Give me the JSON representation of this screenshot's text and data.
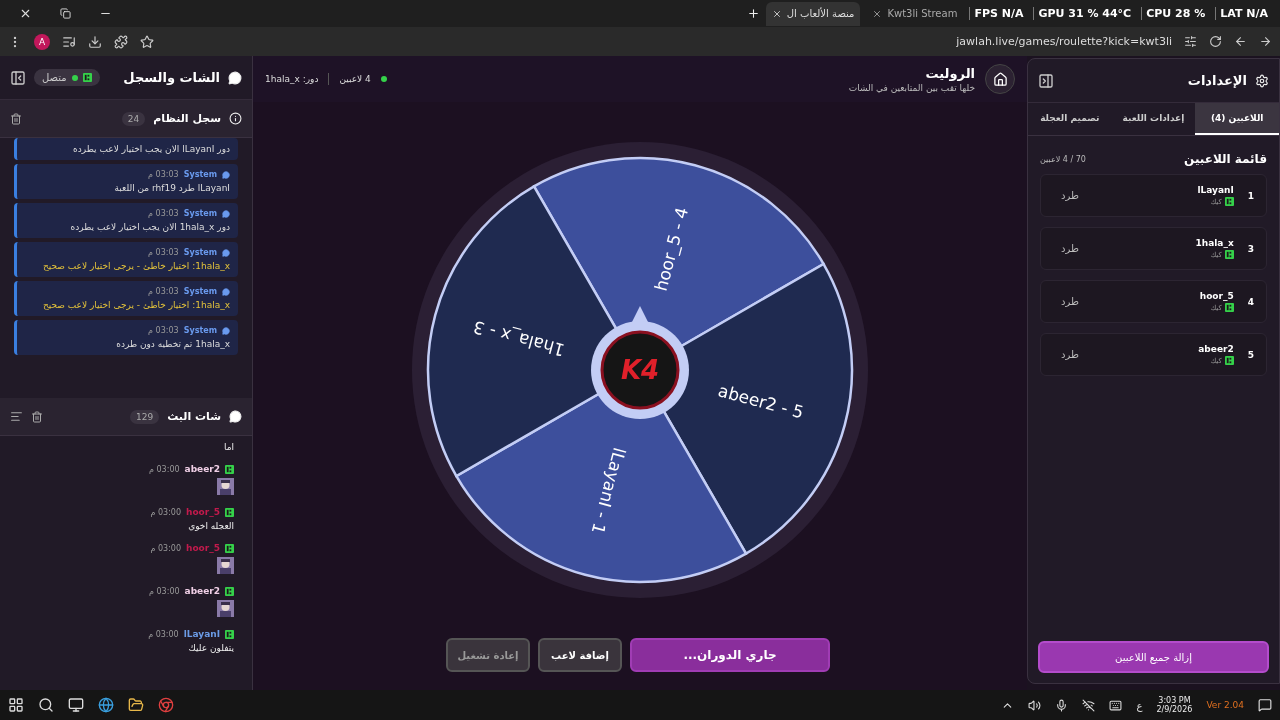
{
  "browser": {
    "tabs": [
      {
        "title": "Kwt3li Stream",
        "selected": false
      },
      {
        "title": "منصة الألعاب ال",
        "selected": true
      }
    ],
    "overlay": [
      "LAT N/A",
      "CPU 28 %",
      "GPU 31 % 44°C",
      "FPS N/A"
    ],
    "avatar": "A",
    "url": "jawlah.live/games/roulette?kick=kwt3li"
  },
  "chat_panel": {
    "title": "الشات والسجل",
    "status": "متصل",
    "system_log": {
      "title": "سجل النظام",
      "count": "24",
      "messages": [
        {
          "kind": "info",
          "text": "دور lLayanI الان يجب اختيار لاعب يطرده"
        },
        {
          "kind": "info",
          "sender": "System",
          "time": "03:03 م",
          "text": "lLayanI طرد rhf19 من اللعبة"
        },
        {
          "kind": "info",
          "sender": "System",
          "time": "03:03 م",
          "text": "دور 1hala_x الان يجب اختيار لاعب يطرده"
        },
        {
          "kind": "warning",
          "sender": "System",
          "time": "03:03 م",
          "text": "1hala_x: اختيار خاطئ - يرجى اختيار لاعب صحيح"
        },
        {
          "kind": "warning",
          "sender": "System",
          "time": "03:03 م",
          "text": "1hala_x: اختيار خاطئ - يرجى اختيار لاعب صحيح"
        },
        {
          "kind": "info",
          "sender": "System",
          "time": "03:03 م",
          "text": "1hala_x تم تخطيه دون طرده"
        }
      ]
    },
    "stream_chat": {
      "title": "شات البث",
      "count": "129",
      "messages": [
        {
          "kind": "text",
          "text": "اما"
        },
        {
          "kind": "sticker",
          "user": "abeer2",
          "color": "#f0cfe6",
          "time": "03:00 م"
        },
        {
          "kind": "text",
          "user": "hoor_5",
          "color": "#c21a4c",
          "time": "03:00 م",
          "text": "العجله اخوي"
        },
        {
          "kind": "sticker",
          "user": "hoor_5",
          "color": "#c21a4c",
          "time": "03:00 م"
        },
        {
          "kind": "sticker",
          "user": "abeer2",
          "color": "#f0cfe6",
          "time": "03:00 م"
        },
        {
          "kind": "text",
          "user": "lLayanI",
          "color": "#6b9be6",
          "time": "03:00 م",
          "text": "يتفلون عليك"
        }
      ]
    }
  },
  "game": {
    "title": "الروليت",
    "subtitle": "خلها تقب بين المتابعين في الشات",
    "players_count": "4 لاعبين",
    "turn": "دور: 1hala_x",
    "wheel": {
      "hub_logo": "K4",
      "segments": [
        {
          "label": "hoor_5 - 4",
          "color": "#3d4f9c"
        },
        {
          "label": "abeer2 - 5",
          "color": "#1f2a50"
        },
        {
          "label": "lLayanI - 1",
          "color": "#3d4f9c"
        },
        {
          "label": "1hala_x - 3",
          "color": "#1f2a50"
        }
      ]
    },
    "buttons": [
      {
        "label": "جاري الدوران...",
        "kind": "primary",
        "disabled": false
      },
      {
        "label": "إضافة لاعب",
        "kind": "secondary",
        "disabled": false
      },
      {
        "label": "إعادة تشغيل",
        "kind": "secondary",
        "disabled": true
      }
    ]
  },
  "settings": {
    "title": "الإعدادات",
    "tabs": [
      {
        "label": "اللاعبين (4)",
        "selected": true
      },
      {
        "label": "إعدادات اللعبة",
        "selected": false
      },
      {
        "label": "تصميم العجلة",
        "selected": false
      }
    ],
    "list_title": "قائمة اللاعبين",
    "list_count": "70 / 4 لاعبين",
    "players": [
      {
        "number": "1",
        "name": "lLayanI",
        "platform": "كيك",
        "action": "طرد"
      },
      {
        "number": "3",
        "name": "1hala_x",
        "platform": "كيك",
        "action": "طرد"
      },
      {
        "number": "4",
        "name": "hoor_5",
        "platform": "كيك",
        "action": "طرد"
      },
      {
        "number": "5",
        "name": "abeer2",
        "platform": "كيك",
        "action": "طرد"
      }
    ],
    "remove_all": "إزالة جميع اللاعبين"
  },
  "taskbar": {
    "language": "ع",
    "time": "3:03 PM",
    "date": "2/9/2026",
    "version": "Ver 2.04"
  }
}
